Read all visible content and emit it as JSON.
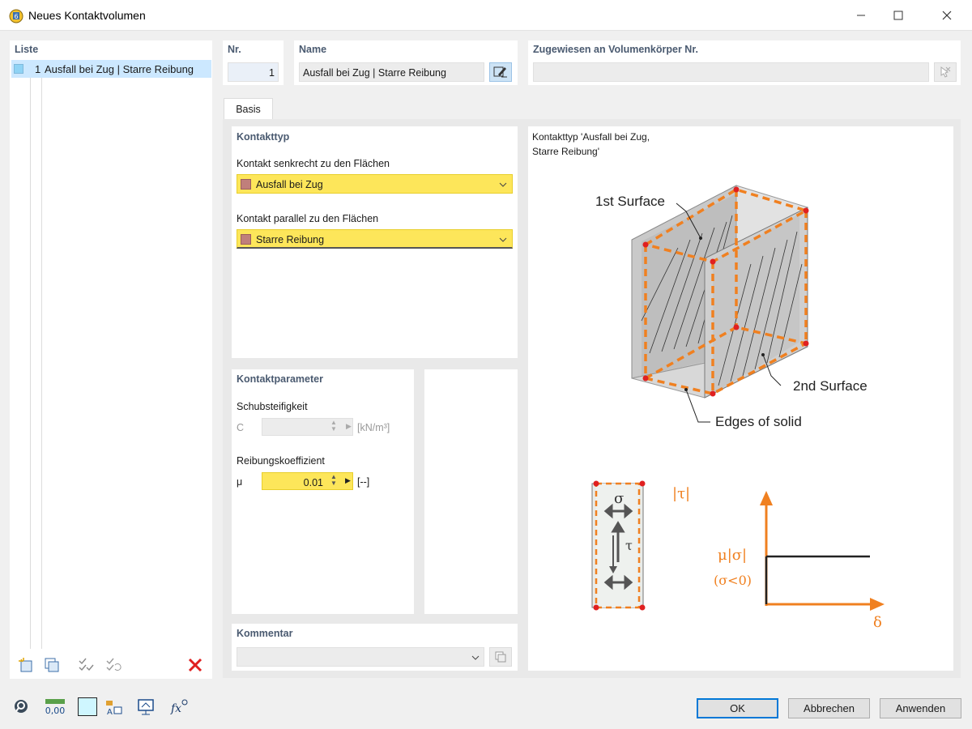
{
  "window": {
    "title": "Neues Kontaktvolumen"
  },
  "list": {
    "header": "Liste",
    "items": [
      {
        "number": "1",
        "label": "Ausfall bei Zug | Starre Reibung"
      }
    ]
  },
  "nr": {
    "header": "Nr.",
    "value": "1"
  },
  "name": {
    "header": "Name",
    "value": "Ausfall bei Zug | Starre Reibung"
  },
  "assigned": {
    "header": "Zugewiesen an Volumenkörper Nr.",
    "value": ""
  },
  "tabs": [
    {
      "label": "Basis"
    }
  ],
  "kontakttyp": {
    "header": "Kontakttyp",
    "perpendicular_label": "Kontakt senkrecht zu den Flächen",
    "perpendicular_value": "Ausfall bei Zug",
    "parallel_label": "Kontakt parallel zu den Flächen",
    "parallel_value": "Starre Reibung"
  },
  "parameter": {
    "header": "Kontaktparameter",
    "shear_label": "Schubsteifigkeit",
    "shear_symbol": "C",
    "shear_value": "",
    "shear_unit": "[kN/m³]",
    "friction_label": "Reibungskoeffizient",
    "friction_symbol": "μ",
    "friction_value": "0.01",
    "friction_unit": "[--]"
  },
  "comment": {
    "header": "Kommentar",
    "value": ""
  },
  "preview": {
    "caption_line1": "Kontakttyp 'Ausfall bei Zug,",
    "caption_line2": "Starre Reibung'",
    "label_first_surface": "1st Surface",
    "label_second_surface": "2nd Surface",
    "label_edges": "Edges of solid",
    "sigma": "σ",
    "tau": "τ",
    "tau_abs": "|τ|",
    "mu_sigma": "μ|σ|",
    "condition": "(σ<0)",
    "delta": "δ"
  },
  "buttons": {
    "ok": "OK",
    "cancel": "Abbrechen",
    "apply": "Anwenden"
  },
  "colors": {
    "accent_yellow": "#fde65a",
    "swatch": "#c07f7b",
    "orange": "#f08020",
    "selection": "#cce8ff",
    "delete_red": "#e02020"
  },
  "icons": {
    "list_toolbar": [
      "new-item-icon",
      "copy-item-icon",
      "check-all-icon",
      "check-renumber-icon",
      "delete-icon"
    ],
    "footer_toolbar": [
      "search-help-icon",
      "units-icon",
      "color-swatch-icon",
      "display-settings-icon",
      "render-icon",
      "formula-icon"
    ]
  }
}
